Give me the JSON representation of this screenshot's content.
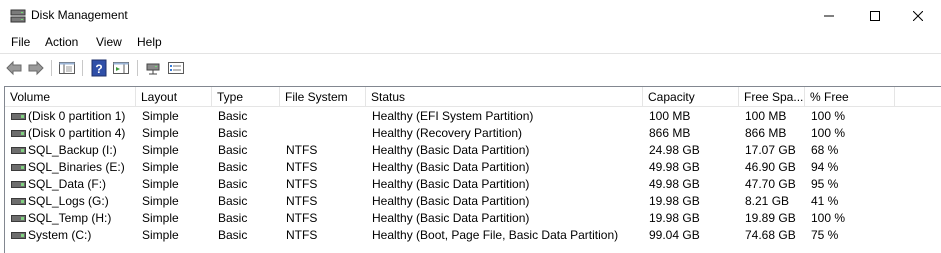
{
  "window": {
    "title": "Disk Management"
  },
  "menu": [
    "File",
    "Action",
    "View",
    "Help"
  ],
  "toolbar": {
    "buttons": [
      "back-icon",
      "forward-icon",
      "show-hide-console-tree-icon",
      "help-icon",
      "show-hide-action-pane-icon",
      "connect-icon",
      "properties-icon"
    ]
  },
  "columns": [
    "Volume",
    "Layout",
    "Type",
    "File System",
    "Status",
    "Capacity",
    "Free Spa...",
    "% Free"
  ],
  "rows": [
    {
      "volume": "(Disk 0 partition 1)",
      "layout": "Simple",
      "type": "Basic",
      "fs": "",
      "status": "Healthy (EFI System Partition)",
      "capacity": "100 MB",
      "free": "100 MB",
      "pct": "100 %"
    },
    {
      "volume": "(Disk 0 partition 4)",
      "layout": "Simple",
      "type": "Basic",
      "fs": "",
      "status": "Healthy (Recovery Partition)",
      "capacity": "866 MB",
      "free": "866 MB",
      "pct": "100 %"
    },
    {
      "volume": "SQL_Backup (I:)",
      "layout": "Simple",
      "type": "Basic",
      "fs": "NTFS",
      "status": "Healthy (Basic Data Partition)",
      "capacity": "24.98 GB",
      "free": "17.07 GB",
      "pct": "68 %"
    },
    {
      "volume": "SQL_Binaries (E:)",
      "layout": "Simple",
      "type": "Basic",
      "fs": "NTFS",
      "status": "Healthy (Basic Data Partition)",
      "capacity": "49.98 GB",
      "free": "46.90 GB",
      "pct": "94 %"
    },
    {
      "volume": "SQL_Data (F:)",
      "layout": "Simple",
      "type": "Basic",
      "fs": "NTFS",
      "status": "Healthy (Basic Data Partition)",
      "capacity": "49.98 GB",
      "free": "47.70 GB",
      "pct": "95 %"
    },
    {
      "volume": "SQL_Logs (G:)",
      "layout": "Simple",
      "type": "Basic",
      "fs": "NTFS",
      "status": "Healthy (Basic Data Partition)",
      "capacity": "19.98 GB",
      "free": "8.21 GB",
      "pct": "41 %"
    },
    {
      "volume": "SQL_Temp (H:)",
      "layout": "Simple",
      "type": "Basic",
      "fs": "NTFS",
      "status": "Healthy (Basic Data Partition)",
      "capacity": "19.98 GB",
      "free": "19.89 GB",
      "pct": "100 %"
    },
    {
      "volume": "System (C:)",
      "layout": "Simple",
      "type": "Basic",
      "fs": "NTFS",
      "status": "Healthy (Boot, Page File, Basic Data Partition)",
      "capacity": "99.04 GB",
      "free": "74.68 GB",
      "pct": "75 %"
    }
  ]
}
